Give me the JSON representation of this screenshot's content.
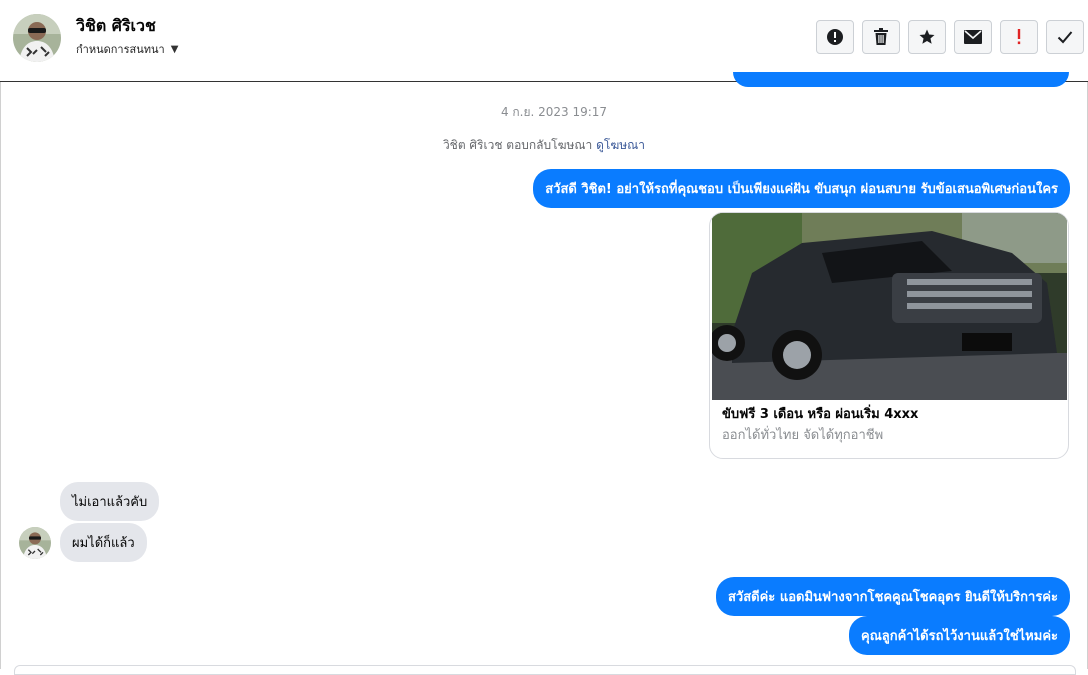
{
  "contact": {
    "name": "วิชิต ศิริเวช",
    "conversation_setting": "กำหนดการสนทนา",
    "avatar_icon": "user-avatar"
  },
  "toolbar": [
    {
      "name": "report-button",
      "icon": "exclamation-circle-icon",
      "tooltip": "Report"
    },
    {
      "name": "delete-button",
      "icon": "trash-icon",
      "tooltip": "Delete"
    },
    {
      "name": "star-button",
      "icon": "star-icon",
      "tooltip": "Star"
    },
    {
      "name": "mark-unread-button",
      "icon": "envelope-icon",
      "tooltip": "Mark as unread"
    },
    {
      "name": "follow-up-button",
      "icon": "exclamation-icon",
      "tooltip": "Follow up"
    },
    {
      "name": "mark-done-button",
      "icon": "checkmark-icon",
      "tooltip": "Done"
    }
  ],
  "thread": {
    "timestamp": "4 ก.ย. 2023 19:17",
    "ad_reply_note": "วิชิต ศิริเวช ตอบกลับโฆษณา",
    "ad_reply_link": "ดูโฆษณา",
    "greeting": "สวัสดี วิชิต! อย่าให้รถที่คุณชอบ เป็นเพียงแค่ฝัน ขับสนุก ผ่อนสบาย รับข้อเสนอพิเศษก่อนใคร",
    "ad_card": {
      "title": "ขับฟรี 3 เดือน หรือ ผ่อนเริ่ม 4xxx",
      "subtitle": "ออกได้ทั่วไทย จัดได้ทุกอาชีพ"
    },
    "incoming": [
      "ไม่เอาแล้วคับ",
      "ผมได้ก็แล้ว"
    ],
    "outgoing_replies": [
      "สวัสดีค่ะ แอดมินฟางจากโชคคูณโชคอุดร ยินดีให้บริการค่ะ",
      "คุณลูกค้าได้รถไว้งานแล้วใช่ไหมค่ะ"
    ]
  },
  "colors": {
    "accent_blue": "#0a7cff",
    "incoming_bubble": "#e4e6eb",
    "follow_up_red": "#e02424"
  }
}
